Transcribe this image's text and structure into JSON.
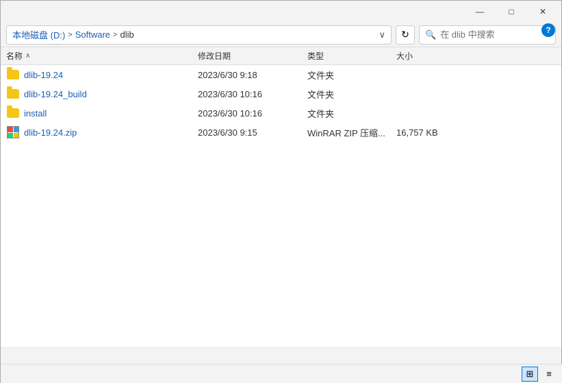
{
  "titlebar": {
    "minimize_label": "—",
    "maximize_label": "□",
    "close_label": "✕"
  },
  "addressbar": {
    "drive": "本地磁盘 (D:)",
    "sep1": ">",
    "folder1": "Software",
    "sep2": ">",
    "folder2": "dlib",
    "refresh_icon": "↻",
    "search_placeholder": "在 dlib 中搜索",
    "chevron": "∨"
  },
  "help": {
    "label": "?"
  },
  "columns": {
    "name": "名称",
    "sort_arrow": "∧",
    "date": "修改日期",
    "type": "类型",
    "size": "大小"
  },
  "files": [
    {
      "name": "dlib-19.24",
      "date": "2023/6/30 9:18",
      "type": "文件夹",
      "size": "",
      "kind": "folder"
    },
    {
      "name": "dlib-19.24_build",
      "date": "2023/6/30 10:16",
      "type": "文件夹",
      "size": "",
      "kind": "folder"
    },
    {
      "name": "install",
      "date": "2023/6/30 10:16",
      "type": "文件夹",
      "size": "",
      "kind": "folder"
    },
    {
      "name": "dlib-19.24.zip",
      "date": "2023/6/30 9:15",
      "type": "WinRAR ZIP 压缩...",
      "size": "16,757 KB",
      "kind": "zip"
    }
  ],
  "statusbar": {
    "view_grid_icon": "⊞",
    "view_list_icon": "≡"
  }
}
